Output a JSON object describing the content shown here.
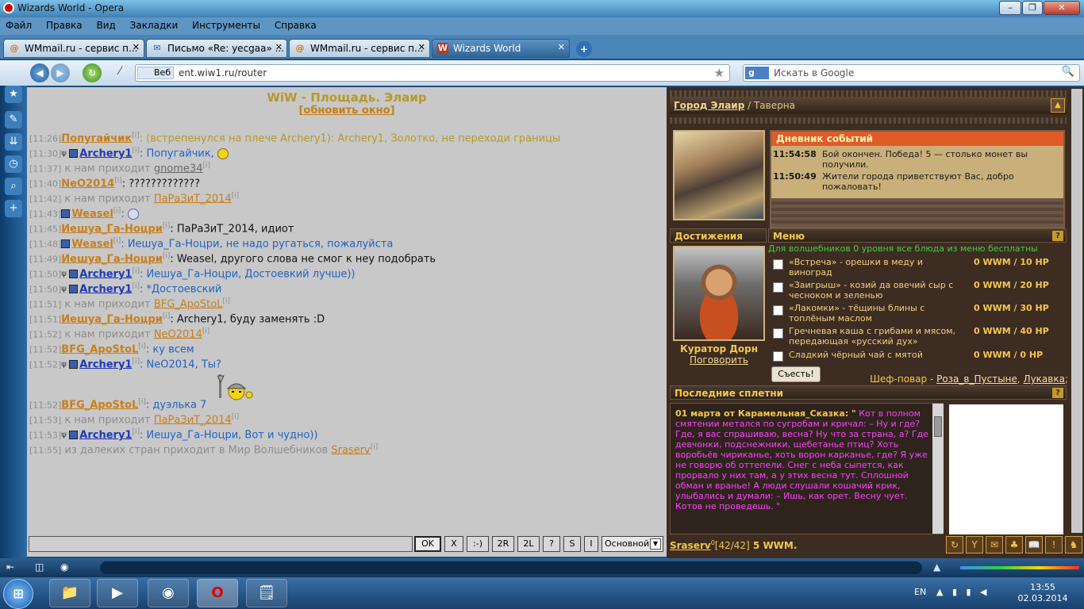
{
  "window": {
    "title": "Wizards World - Opera",
    "min": "–",
    "max": "❐",
    "close": "✕"
  },
  "menu": [
    "Файл",
    "Правка",
    "Вид",
    "Закладки",
    "Инструменты",
    "Справка"
  ],
  "tabs": [
    {
      "label": "WMmail.ru - сервис п...",
      "icon": "@",
      "close": "✕"
    },
    {
      "label": "Письмо «Re: yecgaa» ...",
      "icon": "✉",
      "close": "✕"
    },
    {
      "label": "WMmail.ru - сервис п...",
      "icon": "@",
      "close": "✕"
    },
    {
      "label": "Wizards World",
      "icon": "W",
      "close": "✕"
    }
  ],
  "new_tab": "+",
  "address": {
    "scope": "Веб",
    "url": "ent.wiw1.ru/router",
    "star": "★"
  },
  "search": {
    "engine": "g",
    "placeholder": "Искать в Google",
    "go": "🔍"
  },
  "chat": {
    "title": "WiW - Площадь. Элаир",
    "refresh": "обновить окно",
    "lines": [
      {
        "ts": "[11:26]",
        "nick": "Попугайчик",
        "info": "[i]",
        "msg": ": (встрепенулся на плече Archery1): Archery1, Золотко, не переходи границы"
      },
      {
        "ts": "[11:30]",
        "nick": "Archery1",
        "info": "[i]",
        "msg": ": Попугайчик, "
      },
      {
        "ts": "[11:37]",
        "pre": " к нам приходит ",
        "nick": "gnome34",
        "info": "[i]"
      },
      {
        "ts": "[11:40]",
        "nick": "NeO2014",
        "info": "[i]",
        "msg": ": ?????????????"
      },
      {
        "ts": "[11:42]",
        "pre": " к нам приходит ",
        "nick": "ПаРаЗиТ_2014",
        "info": "[i]"
      },
      {
        "ts": "[11:43]",
        "nick": "Weasel",
        "info": "[i]",
        "msg": ": "
      },
      {
        "ts": "[11:45]",
        "nick": "Иешуа_Га-Ноцри",
        "info": "[i]",
        "msg": ": ПаРаЗиТ_2014, идиот"
      },
      {
        "ts": "[11:48]",
        "nick": "Weasel",
        "info": "[i]",
        "msg": ": Иешуа_Га-Ноцри, не надо ругаться, пожалуйста"
      },
      {
        "ts": "[11:49]",
        "nick": "Иешуа_Га-Ноцри",
        "info": "[i]",
        "msg": ": Weasel, другого слова не смог к неу подобрать"
      },
      {
        "ts": "[11:50]",
        "nick": "Archery1",
        "info": "[i]",
        "msg": ": Иешуа_Га-Ноцри, Достоевкий лучше))"
      },
      {
        "ts": "[11:50]",
        "nick": "Archery1",
        "info": "[i]",
        "msg": ": *Достоевский"
      },
      {
        "ts": "[11:51]",
        "pre": " к нам приходит ",
        "nick": "BFG_ApoStoL",
        "info": "[i]"
      },
      {
        "ts": "[11:51]",
        "nick": "Иешуа_Га-Ноцри",
        "info": "[i]",
        "msg": ": Archery1, буду заменять :D"
      },
      {
        "ts": "[11:52]",
        "pre": " к нам приходит ",
        "nick": "NeO2014",
        "info": "[i]"
      },
      {
        "ts": "[11:52]",
        "nick": "BFG_ApoStoL",
        "info": "[i]",
        "msg": ": ку всем"
      },
      {
        "ts": "[11:52]",
        "nick": "Archery1",
        "info": "[i]",
        "msg": ": NeO2014, Ты?"
      },
      {
        "ts": "[11:52]",
        "nick": "BFG_ApoStoL",
        "info": "[i]",
        "msg": ": дуэлька 7"
      },
      {
        "ts": "[11:53]",
        "pre": " к нам приходит ",
        "nick": "ПаРаЗиТ_2014",
        "info": "[i]"
      },
      {
        "ts": "[11:53]",
        "nick": "Archery1",
        "info": "[i]",
        "msg": ": Иешуа_Га-Ноцри, Вот и чудно))"
      },
      {
        "ts": "[11:55]",
        "pre": " из далеких стран приходит в Мир Волшебников ",
        "nick": "Sraserv",
        "info": "[i]"
      }
    ],
    "buttons": [
      "OK",
      "X",
      ":-)",
      "2R",
      "2L",
      "?",
      "S",
      "I"
    ],
    "channel": "Основной",
    "channel_arrow": "▼"
  },
  "game": {
    "city": "Город Элаир",
    "place": " / Таверна",
    "collapse": "▲",
    "diary_title": "Дневник событий",
    "diary": [
      {
        "time": "11:54:58",
        "text": "Бой окончен. Победа! 5 — столько монет вы получили."
      },
      {
        "time": "11:50:49",
        "text": "Жители города приветствуют Вас, добро пожаловать!"
      }
    ],
    "achievements_title": "Достижения",
    "menu_title": "Меню",
    "help": "?",
    "menu_free": "Для волшебников 0 уровня все блюда из меню бесплатны",
    "menu_items": [
      {
        "name": "«Встреча» - орешки в меду и виноград",
        "price": "0 WWM / 10 HP"
      },
      {
        "name": "«Заигрыш» - козий да овечий сыр с чесноком и зеленью",
        "price": "0 WWM / 20 HP"
      },
      {
        "name": "«Лакомки» - тёщины блины с топлёным маслом",
        "price": "0 WWM / 30 HP"
      },
      {
        "name": "Гречневая каша с грибами и мясом, передающая «русский дух»",
        "price": "0 WWM / 40 HP"
      },
      {
        "name": "Сладкий чёрный чай с мятой",
        "price": "0 WWM / 0 HP"
      }
    ],
    "eat_button": "Съесть!",
    "curator": "Куратор Дорн",
    "talk": "Поговорить",
    "chef_label": "Шеф-повар - ",
    "chef_1": "Роза_в_Пустыне",
    "chef_sep": ", ",
    "chef_2": "Лукавка",
    "chef_end": ";",
    "gossip_title": "Последние сплетни",
    "gossip_header": "01 марта от Карамельная_Сказка: \"",
    "gossip_text": "Кот в полном смятении метался по сугробам и кричал: – Ну и где? Где, я вас спрашиваю, весна? Ну что за страна, а? Где девчонки, подснежники, щебетанье птиц? Хоть воробьёв чириканье, хоть ворон карканье, где? Я уже не говорю об оттепели. Снег с неба сыпется, как прорвало у них там, а у этих весна тут. Сплошной обман и вранье! А люди слушали кошачий крик, улыбались и думали: – Ишь, как орет. Весну чует. Котов не проведешь. \"",
    "player": "Sraserv",
    "player_level": "0",
    "player_hp": "[42/42]",
    "player_wwm": " 5 WWM.",
    "tools": [
      "↻",
      "Y",
      "✉",
      "♣",
      "📖",
      "!",
      "♞"
    ]
  },
  "taskbar": {
    "start": "⊞",
    "apps": [
      "📁",
      "▶",
      "◉",
      "O",
      "🗒"
    ],
    "lang": "EN",
    "tray": "▲ ▮ ▮ ◀",
    "time": "13:55",
    "date": "02.03.2014"
  }
}
